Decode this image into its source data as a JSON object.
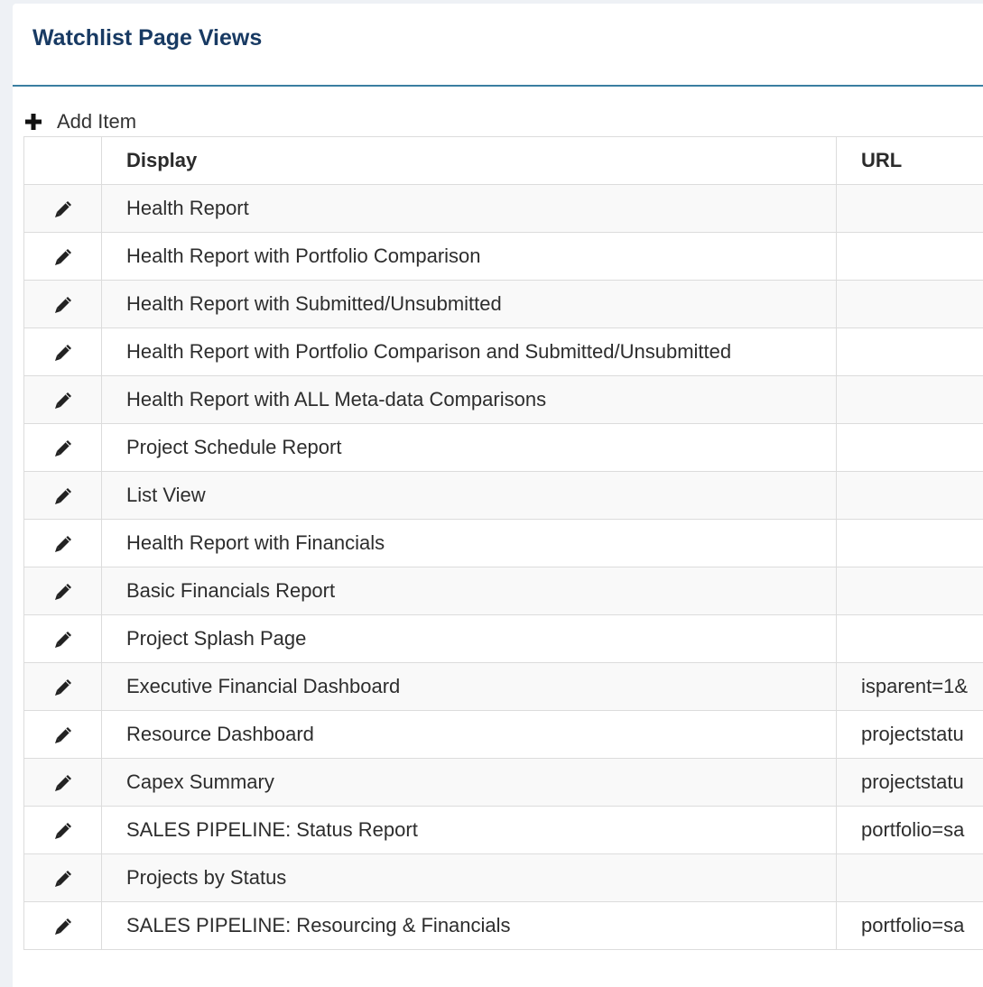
{
  "panel": {
    "title": "Watchlist Page Views"
  },
  "toolbar": {
    "add_label": "Add Item"
  },
  "table": {
    "columns": {
      "edit": "",
      "display": "Display",
      "url": "URL"
    },
    "rows": [
      {
        "display": "Health Report",
        "url": ""
      },
      {
        "display": "Health Report with Portfolio Comparison",
        "url": ""
      },
      {
        "display": "Health Report with Submitted/Unsubmitted",
        "url": ""
      },
      {
        "display": "Health Report with Portfolio Comparison and Submitted/Unsubmitted",
        "url": ""
      },
      {
        "display": "Health Report with ALL Meta-data Comparisons",
        "url": ""
      },
      {
        "display": "Project Schedule Report",
        "url": ""
      },
      {
        "display": "List View",
        "url": ""
      },
      {
        "display": "Health Report with Financials",
        "url": ""
      },
      {
        "display": "Basic Financials Report",
        "url": ""
      },
      {
        "display": "Project Splash Page",
        "url": ""
      },
      {
        "display": "Executive Financial Dashboard",
        "url": "isparent=1&"
      },
      {
        "display": "Resource Dashboard",
        "url": "projectstatu"
      },
      {
        "display": "Capex Summary",
        "url": "projectstatu"
      },
      {
        "display": "SALES PIPELINE: Status Report",
        "url": "portfolio=sa"
      },
      {
        "display": "Projects by Status",
        "url": ""
      },
      {
        "display": "SALES PIPELINE: Resourcing & Financials",
        "url": "portfolio=sa"
      }
    ]
  },
  "icons": {
    "add": "plus-icon",
    "edit": "pencil-icon"
  },
  "colors": {
    "title": "#183a63",
    "header_rule": "#3a7ea1",
    "row_stripe": "#f9f9f9",
    "border": "#dcdcdc"
  }
}
